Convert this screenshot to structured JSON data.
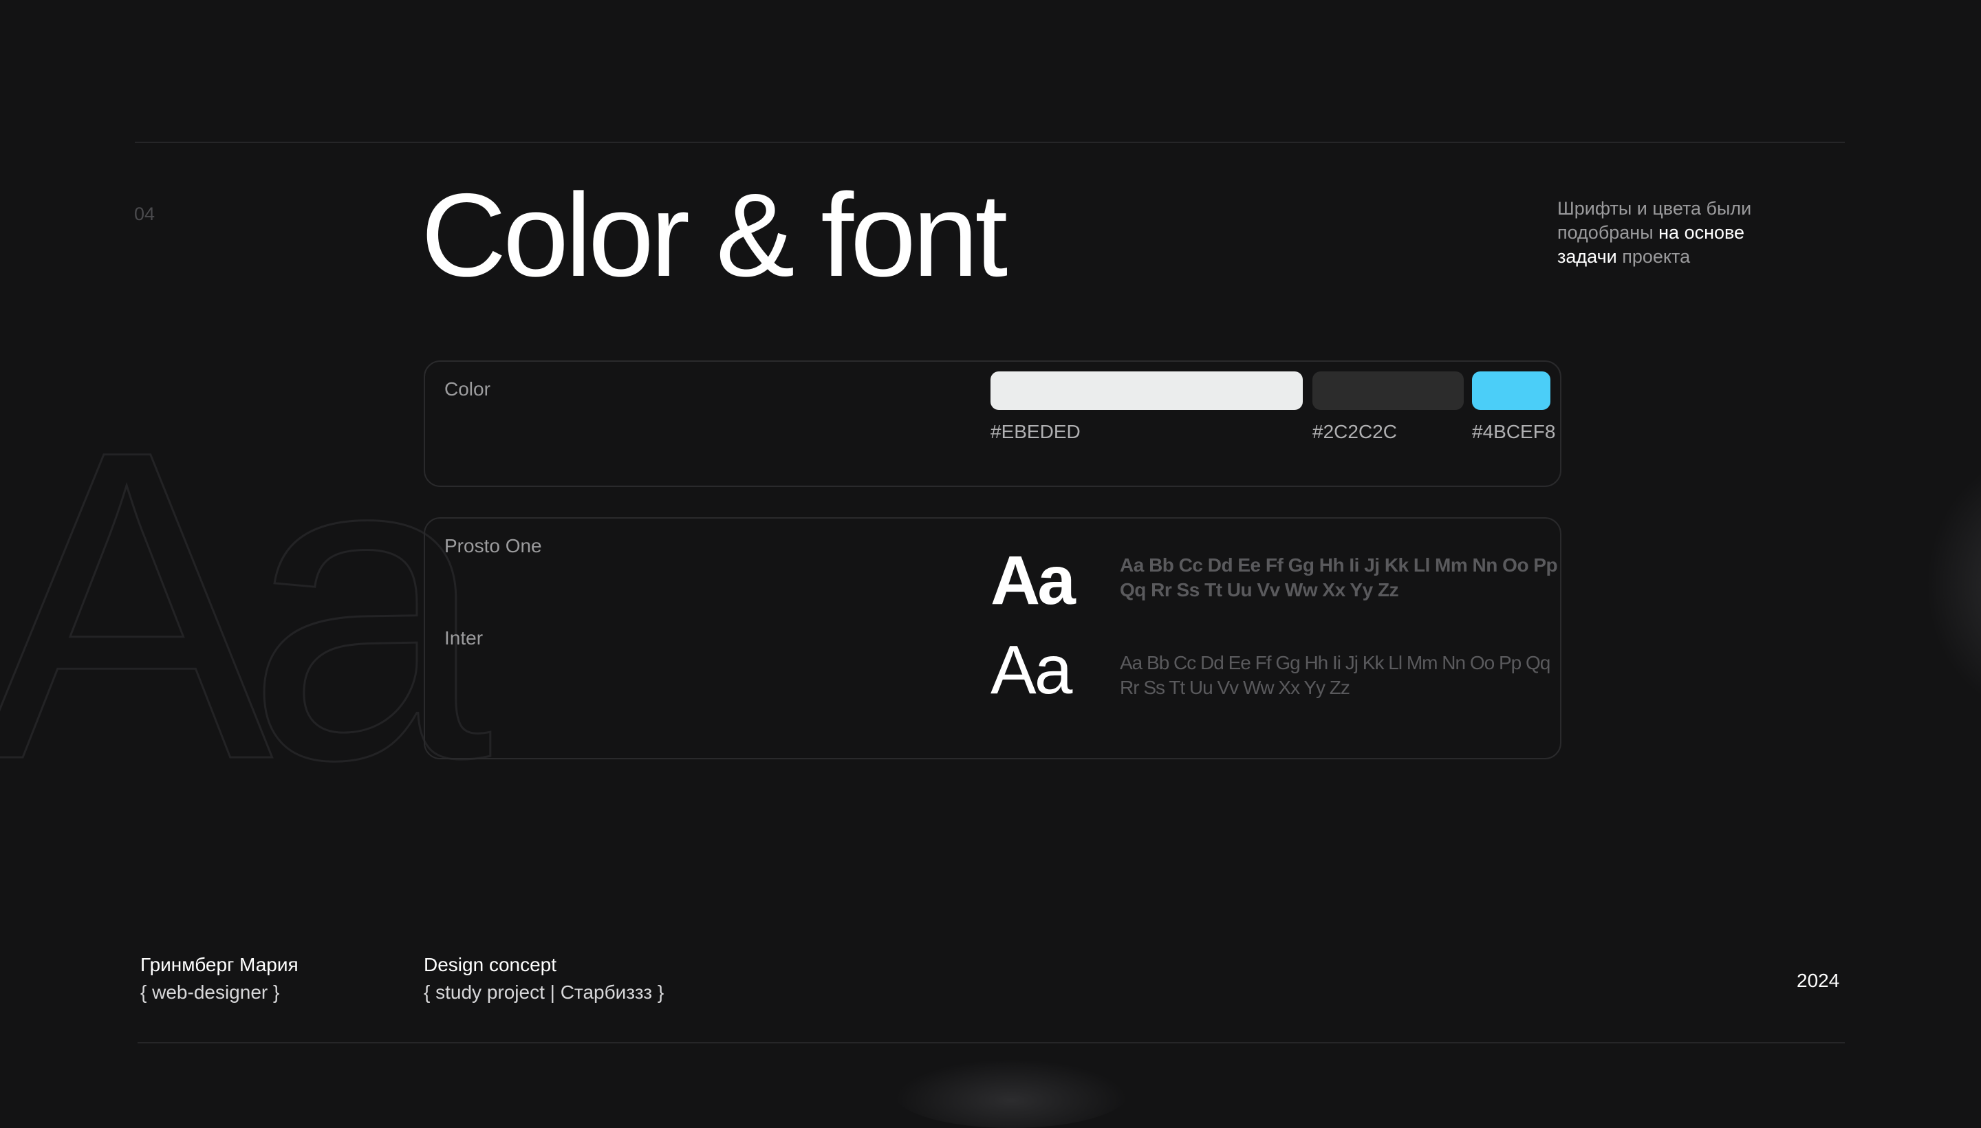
{
  "page": {
    "number": "04",
    "title": "Color & font"
  },
  "note": {
    "part1": "Шрифты и цвета были подобраны ",
    "highlight1": "на основе задачи",
    "part2": " проекта"
  },
  "background_glyph": "Aa",
  "color_card": {
    "label": "Color",
    "swatches": [
      {
        "hex": "#EBEDED",
        "label": "#EBEDED"
      },
      {
        "hex": "#2C2C2C",
        "label": "#2C2C2C"
      },
      {
        "hex": "#4BCEF8",
        "label": "#4BCEF8"
      }
    ]
  },
  "font_card": {
    "fonts": [
      {
        "name": "Prosto One",
        "sample": "Aa",
        "alphabet": "Aa Bb Cc Dd Ee Ff Gg Hh Ii Jj Kk Ll Mm Nn Oo Pp Qq Rr Ss Tt Uu Vv Ww Xx Yy Zz"
      },
      {
        "name": "Inter",
        "sample": "Aa",
        "alphabet": "Aa Bb Cc Dd Ee Ff Gg Hh Ii Jj Kk Ll Mm Nn Oo Pp Qq Rr Ss Tt Uu Vv Ww Xx Yy Zz"
      }
    ]
  },
  "footer": {
    "author_name": "Гринмберг Мария",
    "author_role": "{ web-designer }",
    "project_title": "Design concept",
    "project_sub": "{ study project | Старбиззз }",
    "year": "2024"
  },
  "colors": {
    "background": "#131314",
    "text": "#EBEDED",
    "accent": "#4BCEF8"
  }
}
